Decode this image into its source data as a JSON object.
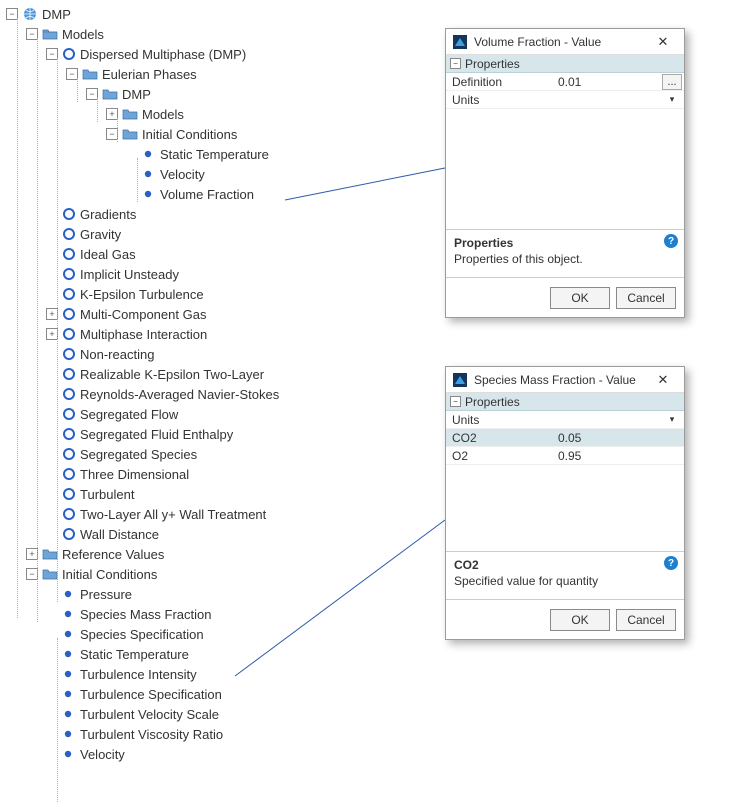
{
  "tree": {
    "root": "DMP",
    "models_folder": "Models",
    "dmp_node": "Dispersed Multiphase (DMP)",
    "eulerian": "Eulerian Phases",
    "dmp_inner": "DMP",
    "inner_models": "Models",
    "initial_conditions_inner": "Initial Conditions",
    "leaf_static_temp": "Static Temperature",
    "leaf_velocity": "Velocity",
    "leaf_volume_fraction": "Volume Fraction",
    "models_list": [
      "Gradients",
      "Gravity",
      "Ideal Gas",
      "Implicit Unsteady",
      "K-Epsilon Turbulence",
      "Multi-Component Gas",
      "Multiphase Interaction",
      "Non-reacting",
      "Realizable K-Epsilon Two-Layer",
      "Reynolds-Averaged Navier-Stokes",
      "Segregated Flow",
      "Segregated Fluid Enthalpy",
      "Segregated Species",
      "Three Dimensional",
      "Turbulent",
      "Two-Layer All y+ Wall Treatment",
      "Wall Distance"
    ],
    "reference_values": "Reference Values",
    "initial_conditions": "Initial Conditions",
    "ic_list": [
      "Pressure",
      "Species Mass Fraction",
      "Species Specification",
      "Static Temperature",
      "Turbulence Intensity",
      "Turbulence Specification",
      "Turbulent Velocity Scale",
      "Turbulent Viscosity Ratio",
      "Velocity"
    ]
  },
  "dialog1": {
    "title": "Volume Fraction - Value",
    "section": "Properties",
    "rows": [
      {
        "k": "Definition",
        "v": "0.01",
        "ellipsis": true
      },
      {
        "k": "Units",
        "v": "",
        "dropdown": true
      }
    ],
    "desc_title": "Properties",
    "desc_text": "Properties of this object.",
    "ok": "OK",
    "cancel": "Cancel"
  },
  "dialog2": {
    "title": "Species Mass Fraction - Value",
    "section": "Properties",
    "rows": [
      {
        "k": "Units",
        "v": "",
        "dropdown": true
      },
      {
        "k": "CO2",
        "v": "0.05",
        "hl": true
      },
      {
        "k": "O2",
        "v": "0.95"
      }
    ],
    "desc_title": "CO2",
    "desc_text": "Specified value for quantity",
    "ok": "OK",
    "cancel": "Cancel"
  },
  "toggles": {
    "plus": "+",
    "minus": "−"
  },
  "glyphs": {
    "chevron_down": "▾",
    "ellipsis": "...",
    "close": "✕",
    "help": "?"
  }
}
